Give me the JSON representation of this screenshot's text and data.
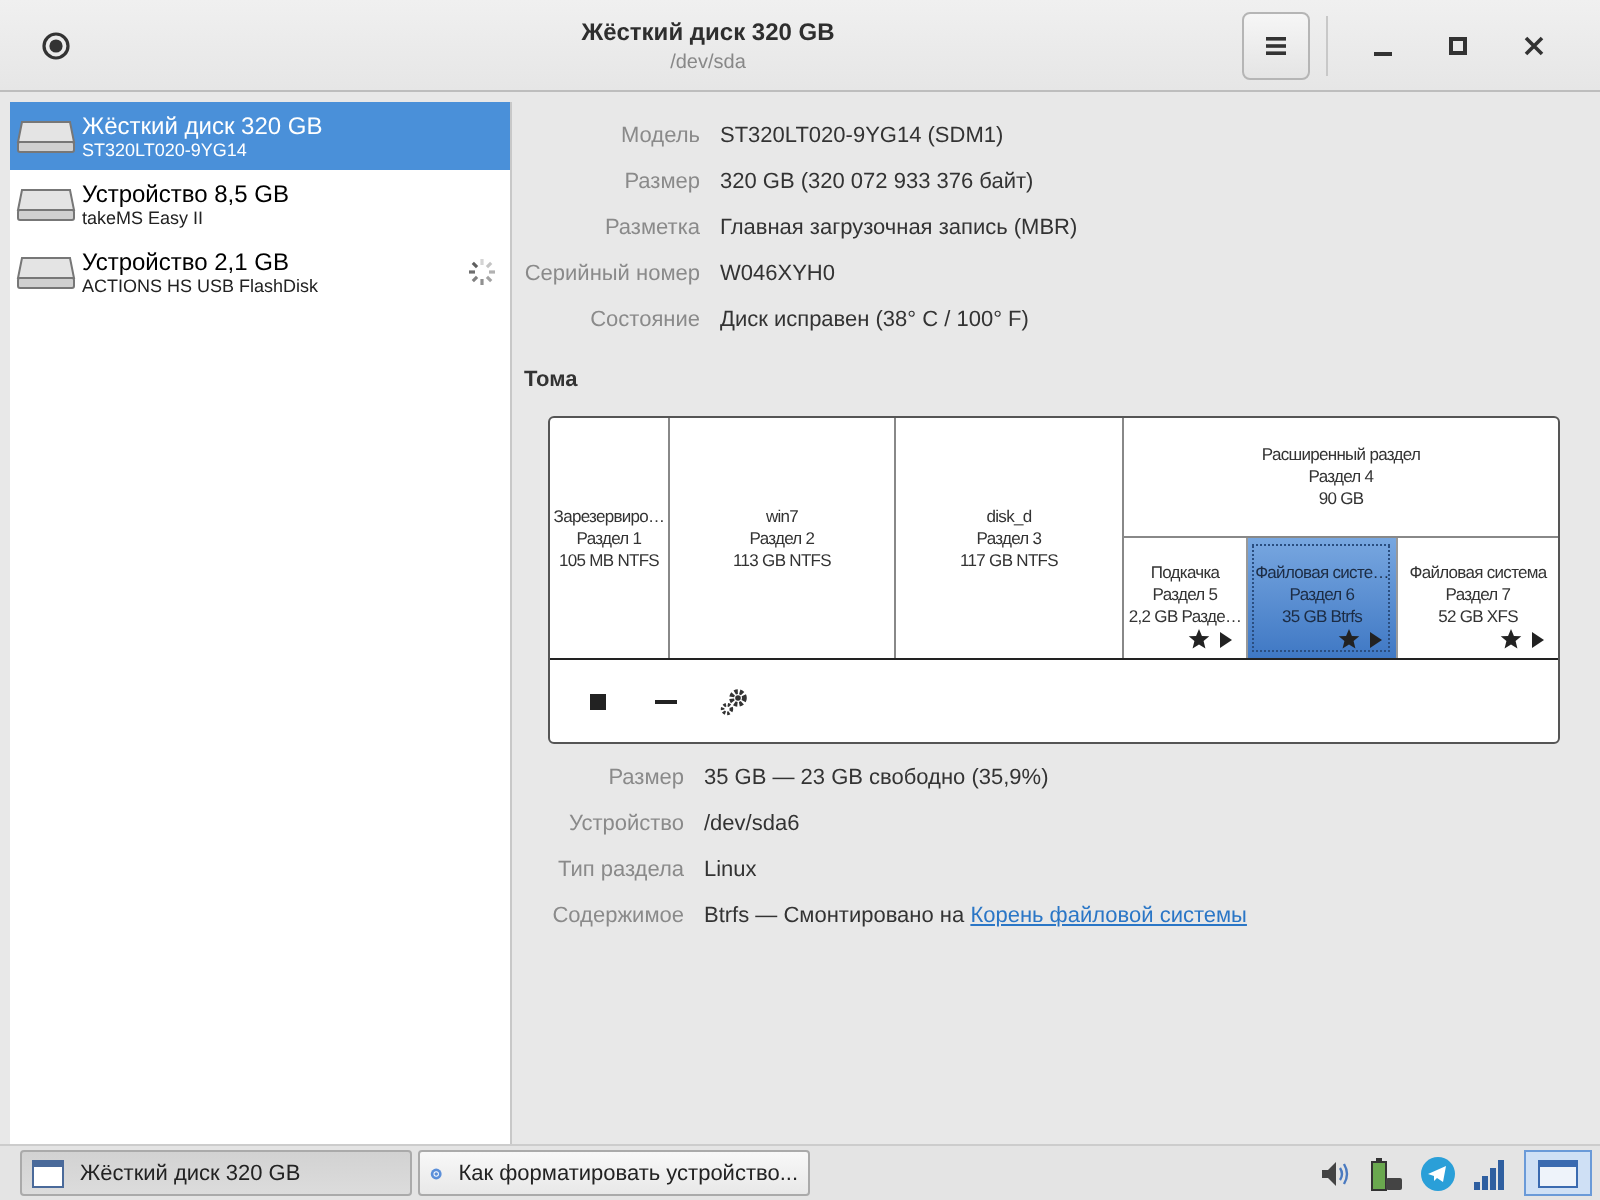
{
  "window": {
    "title": "Жёсткий диск 320 GB",
    "subtitle": "/dev/sda"
  },
  "disks": [
    {
      "name": "Жёсткий диск 320 GB",
      "model": "ST320LT020-9YG14",
      "selected": true,
      "busy": false
    },
    {
      "name": "Устройство 8,5 GB",
      "model": "takeMS Easy II",
      "selected": false,
      "busy": false
    },
    {
      "name": "Устройство 2,1 GB",
      "model": "ACTIONS HS USB FlashDisk",
      "selected": false,
      "busy": true
    }
  ],
  "disk_info": [
    {
      "label": "Модель",
      "value": "ST320LT020-9YG14 (SDM1)"
    },
    {
      "label": "Размер",
      "value": "320 GB (320 072 933 376 байт)"
    },
    {
      "label": "Разметка",
      "value": "Главная загрузочная запись (MBR)"
    },
    {
      "label": "Серийный номер",
      "value": "W046XYH0"
    },
    {
      "label": "Состояние",
      "value": "Диск исправен (38° C / 100° F)"
    }
  ],
  "volumes_heading": "Тома",
  "partitions": [
    {
      "kind": "primary",
      "lines": [
        "Зарезервиро…",
        "Раздел 1",
        "105 MB NTFS"
      ],
      "selected": false
    },
    {
      "kind": "primary",
      "lines": [
        "win7",
        "Раздел 2",
        "113 GB NTFS"
      ],
      "selected": false
    },
    {
      "kind": "primary",
      "lines": [
        "disk_d",
        "Раздел 3",
        "117 GB NTFS"
      ],
      "selected": false
    },
    {
      "kind": "extended",
      "lines": [
        "Расширенный раздел",
        "Раздел 4",
        "90 GB"
      ],
      "selected": false,
      "children": [
        {
          "kind": "logical",
          "lines": [
            "Подкачка",
            "Раздел 5",
            "2,2 GB Разде…"
          ],
          "selected": false
        },
        {
          "kind": "logical",
          "lines": [
            "Файловая систе…",
            "Раздел 6",
            "35 GB Btrfs"
          ],
          "selected": true
        },
        {
          "kind": "logical",
          "lines": [
            "Файловая система",
            "Раздел 7",
            "52 GB XFS"
          ],
          "selected": false
        }
      ]
    }
  ],
  "volume_info": [
    {
      "label": "Размер",
      "value": "35 GB — 23 GB свободно (35,9%)"
    },
    {
      "label": "Устройство",
      "value": "/dev/sda6"
    },
    {
      "label": "Тип раздела",
      "value": "Linux"
    },
    {
      "label": "Содержимое",
      "value": "Btrfs — Смонтировано на ",
      "link": "Корень файловой системы"
    }
  ],
  "taskbar": [
    {
      "kind": "window",
      "label": "Жёсткий диск 320 GB",
      "selected": true
    },
    {
      "kind": "browser",
      "label": "Как форматировать устройство...",
      "selected": false
    }
  ]
}
